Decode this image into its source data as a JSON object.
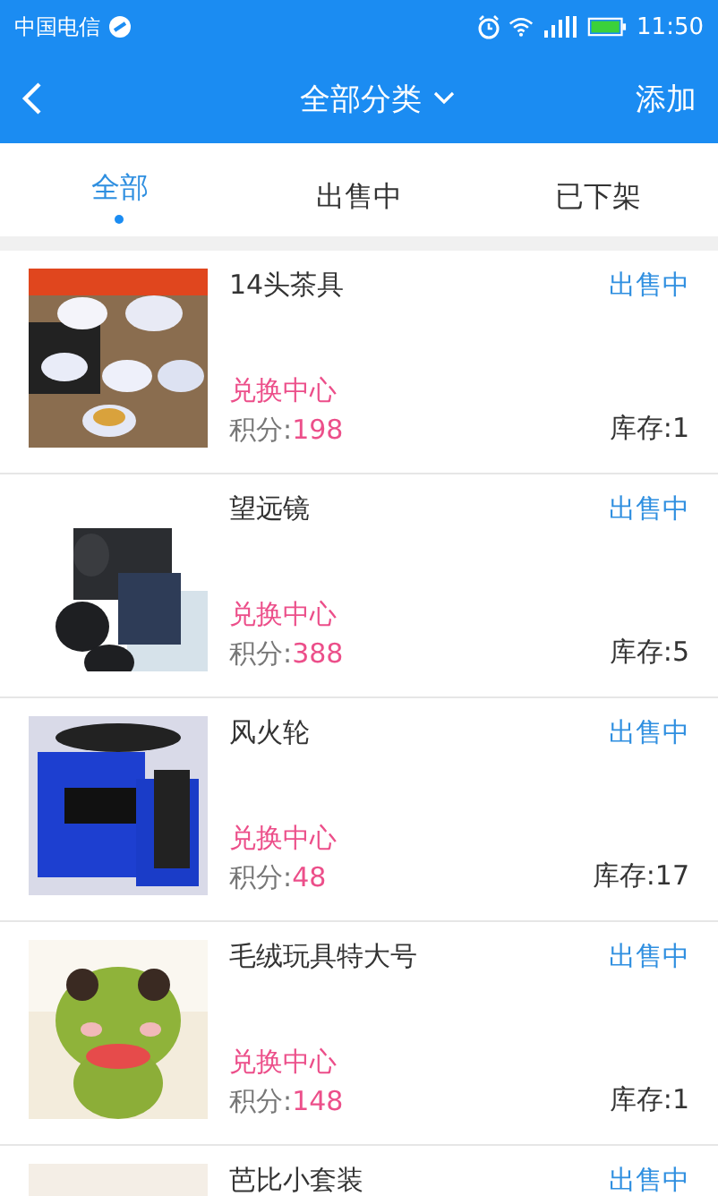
{
  "status_bar": {
    "carrier": "中国电信",
    "time": "11:50"
  },
  "header": {
    "title": "全部分类",
    "action": "添加"
  },
  "tabs": [
    {
      "label": "全部",
      "selected": true
    },
    {
      "label": "出售中",
      "selected": false
    },
    {
      "label": "已下架",
      "selected": false
    }
  ],
  "items": [
    {
      "name": "14头茶具",
      "status": "出售中",
      "tag": "兑换中心",
      "points_label": "积分:",
      "points": "198",
      "stock": "库存:1"
    },
    {
      "name": "望远镜",
      "status": "出售中",
      "tag": "兑换中心",
      "points_label": "积分:",
      "points": "388",
      "stock": "库存:5"
    },
    {
      "name": "风火轮",
      "status": "出售中",
      "tag": "兑换中心",
      "points_label": "积分:",
      "points": "48",
      "stock": "库存:17"
    },
    {
      "name": "毛绒玩具特大号",
      "status": "出售中",
      "tag": "兑换中心",
      "points_label": "积分:",
      "points": "148",
      "stock": "库存:1"
    },
    {
      "name": "芭比小套装",
      "status": "出售中"
    }
  ]
}
